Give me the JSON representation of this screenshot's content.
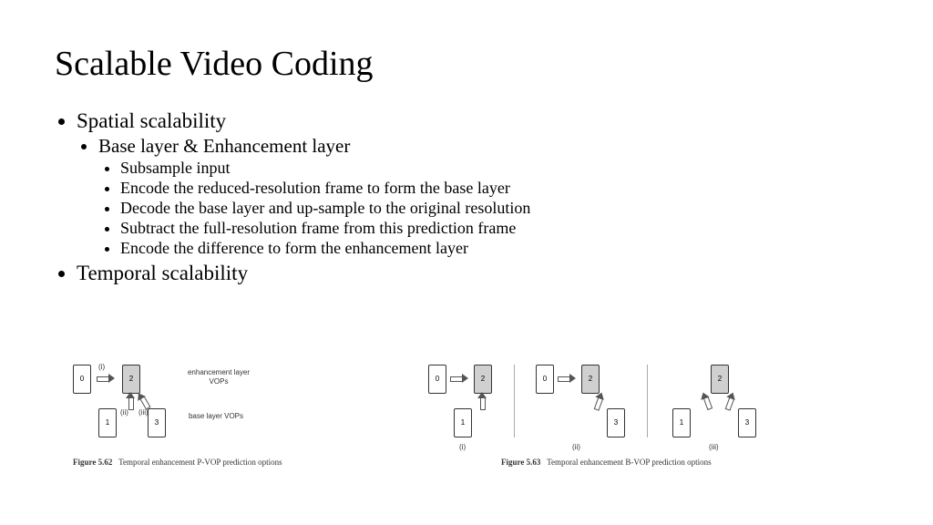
{
  "title": "Scalable Video Coding",
  "bullets": {
    "b1": "Spatial scalability",
    "b1_1": "Base layer & Enhancement layer",
    "b1_1_a": "Subsample input",
    "b1_1_b": "Encode the reduced-resolution frame to form the base layer",
    "b1_1_c": "Decode the base layer and up-sample to the original resolution",
    "b1_1_d": "Subtract the full-resolution frame from this prediction frame",
    "b1_1_e": "Encode the difference to form the enhancement layer",
    "b2": "Temporal scalability"
  },
  "fig62": {
    "caption_prefix": "Figure 5.62",
    "caption": "Temporal enhancement P-VOP prediction options",
    "p0": "0",
    "p1": "1",
    "p2": "2",
    "p3": "3",
    "enh": "enhancement layer VOPs",
    "base": "base layer VOPs",
    "mk_i": "(i)",
    "mk_ii": "(ii)",
    "mk_iii": "(iii)"
  },
  "fig63": {
    "caption_prefix": "Figure 5.63",
    "caption": "Temporal enhancement B-VOP prediction options",
    "p0": "0",
    "p1": "1",
    "p2": "2",
    "p3": "3",
    "mk_i": "(i)",
    "mk_ii": "(ii)",
    "mk_iii": "(iii)"
  }
}
